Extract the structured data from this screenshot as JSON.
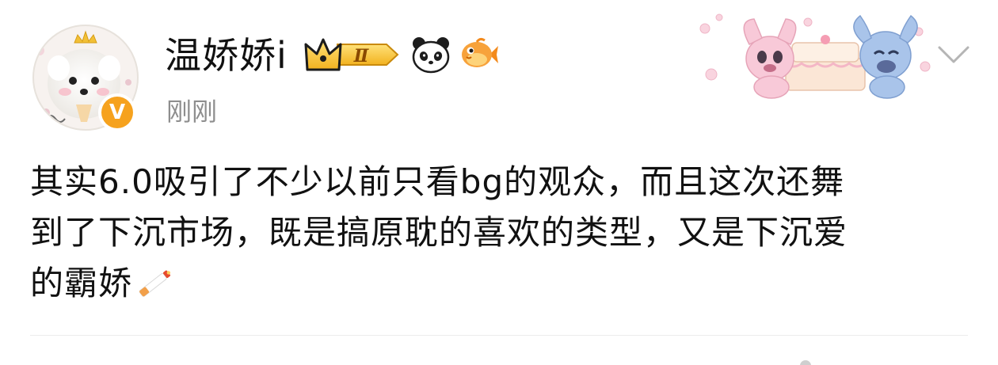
{
  "post": {
    "username": "温娇娇i",
    "timestamp": "刚刚",
    "content_lines": [
      "其实6.0吸引了不少以前只看bg的观众，而且这次还舞",
      "到了下沉市场，既是搞原耽的喜欢的类型，又是下沉爱",
      "的霸娇"
    ],
    "emoji": "cigarette-emoji",
    "badges": {
      "level_roman": "Ⅱ",
      "verified_mark": "V",
      "icons": [
        "crown-level-badge",
        "panda-icon",
        "fish-icon"
      ]
    },
    "menu_icon": "chevron-down-icon"
  },
  "colors": {
    "text": "#111111",
    "timestamp": "#8e8e8e",
    "verified": "#f6a21e",
    "crown_gold": "#f2c037",
    "divider": "#ececec"
  }
}
